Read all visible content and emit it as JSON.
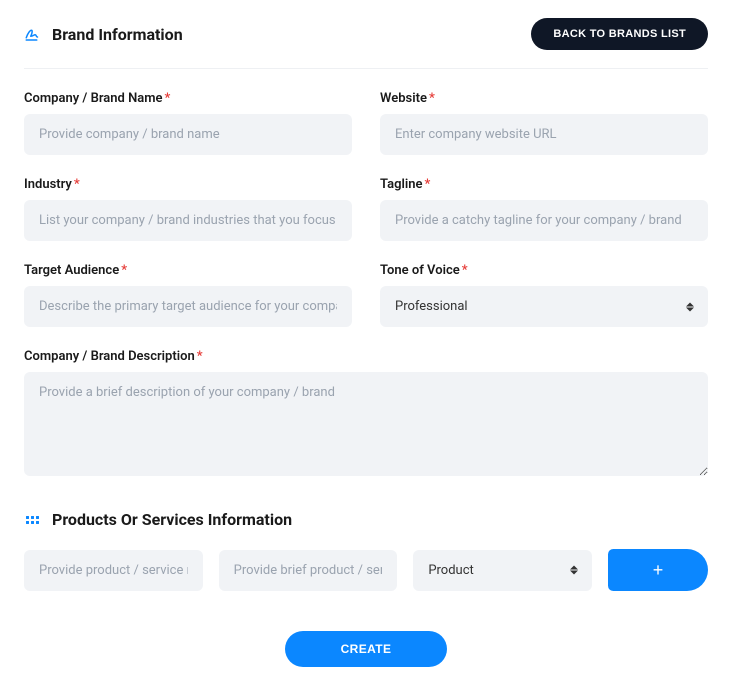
{
  "header": {
    "title": "Brand Information",
    "back_button": "BACK TO BRANDS LIST"
  },
  "fields": {
    "company_name": {
      "label": "Company / Brand Name",
      "placeholder": "Provide company / brand name",
      "value": ""
    },
    "website": {
      "label": "Website",
      "placeholder": "Enter company website URL",
      "value": ""
    },
    "industry": {
      "label": "Industry",
      "placeholder": "List your company / brand industries that you focus on",
      "value": ""
    },
    "tagline": {
      "label": "Tagline",
      "placeholder": "Provide a catchy tagline for your company / brand",
      "value": ""
    },
    "audience": {
      "label": "Target Audience",
      "placeholder": "Describe the primary target audience for your company / brand",
      "value": ""
    },
    "tone": {
      "label": "Tone of Voice",
      "selected": "Professional"
    },
    "description": {
      "label": "Company / Brand Description",
      "placeholder": "Provide a brief description of your company / brand",
      "value": ""
    }
  },
  "products_section": {
    "title": "Products Or Services Information",
    "name_placeholder": "Provide product / service name",
    "desc_placeholder": "Provide brief product / service description",
    "type_selected": "Product",
    "add_label": "+"
  },
  "create_button": "CREATE",
  "colors": {
    "accent": "#0b87ff",
    "dark": "#0f1726",
    "required": "#e53935"
  }
}
